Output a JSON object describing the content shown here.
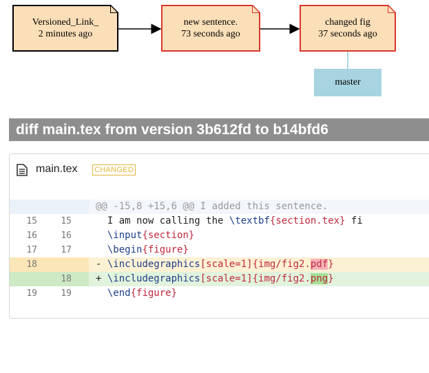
{
  "graph": {
    "commits": [
      {
        "message": "Versioned_Link_",
        "time": "2 minutes ago"
      },
      {
        "message": "new sentence.",
        "time": "73 seconds ago"
      },
      {
        "message": "changed fig",
        "time": "37 seconds ago"
      }
    ],
    "branch": "master"
  },
  "diff": {
    "title": "diff main.tex from version 3b612fd to b14bfd6",
    "file": {
      "name": "main.tex",
      "status": "CHANGED"
    },
    "hunk_header": "@@ -15,8 +15,6 @@ I added this sentence.",
    "lines": [
      {
        "old": "15",
        "new": "15",
        "sign": " ",
        "cmd": "I am now calling the ",
        "kw": "\\textbf",
        "arg": "{section.tex}",
        "rest": " fi"
      },
      {
        "old": "16",
        "new": "16",
        "sign": " ",
        "kw": "\\input",
        "arg": "{section}"
      },
      {
        "old": "17",
        "new": "17",
        "sign": " ",
        "kw": "\\begin",
        "arg": "{figure}"
      },
      {
        "old": "18",
        "new": "",
        "sign": "-",
        "kw": "\\includegraphics",
        "opt": "[scale=1]",
        "pre": "{img/fig2.",
        "hl": "pdf",
        "post": "}"
      },
      {
        "old": "",
        "new": "18",
        "sign": "+",
        "kw": "\\includegraphics",
        "opt": "[scale=1]",
        "pre": "{img/fig2.",
        "hl": "png",
        "post": "}"
      },
      {
        "old": "19",
        "new": "19",
        "sign": " ",
        "kw": "\\end",
        "arg": "{figure}"
      }
    ]
  },
  "colors": {
    "commit_fill": "#fbdfb8",
    "commit_border_new": "#d9352a",
    "branch_fill": "#a7d4e0",
    "title_bar": "#8e8e8e",
    "badge": "#e3b53b",
    "deleted_bg": "#fdf1d4",
    "added_bg": "#e2f3dd"
  }
}
